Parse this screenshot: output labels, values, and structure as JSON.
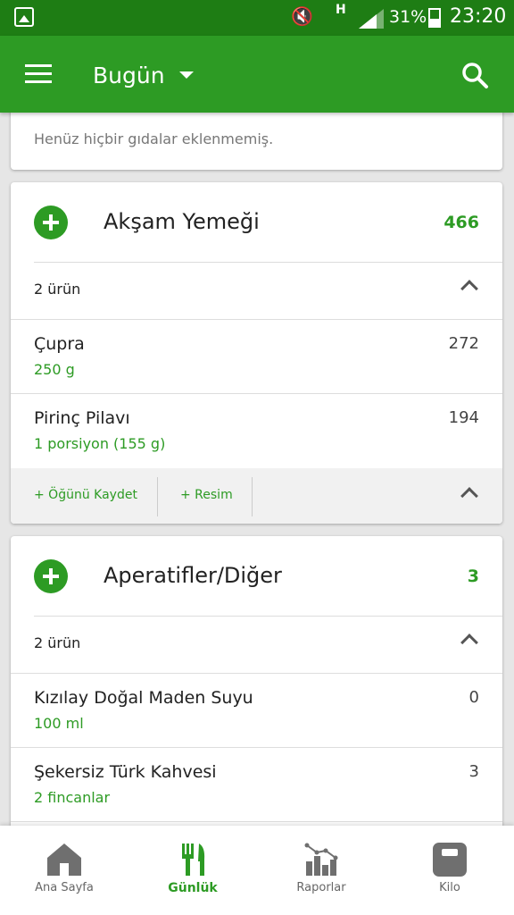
{
  "status_bar": {
    "net_type": "H",
    "battery": "31%",
    "time": "23:20"
  },
  "app_bar": {
    "title": "Bugün",
    "icons": [
      "menu-icon",
      "chevron-down-icon",
      "search-icon"
    ]
  },
  "breakfast_partial": {
    "empty_message": "Henüz hiçbir gıdalar eklenmemiş."
  },
  "meals": [
    {
      "name": "Akşam Yemeği",
      "total": "466",
      "count": "2 ürün",
      "items": [
        {
          "name": "Çupra",
          "amount": "250  g",
          "calories": "272"
        },
        {
          "name": "Pirinç Pilavı",
          "amount": "1  porsiyon (155 g)",
          "calories": "194"
        }
      ],
      "actions": {
        "save": "+ Öğünü Kaydet",
        "photo": "+ Resim"
      }
    },
    {
      "name": "Aperatifler/Diğer",
      "total": "3",
      "count": "2 ürün",
      "items": [
        {
          "name": "Kızılay Doğal Maden Suyu",
          "amount": "100  ml",
          "calories": "0"
        },
        {
          "name": "Şekersiz Türk Kahvesi",
          "amount": "2  fincanlar",
          "calories": "3"
        }
      ]
    }
  ],
  "bottom_nav": [
    {
      "label": "Ana Sayfa",
      "icon": "home-icon",
      "active": false
    },
    {
      "label": "Günlük",
      "icon": "cutlery-icon",
      "active": true
    },
    {
      "label": "Raporlar",
      "icon": "chart-icon",
      "active": false
    },
    {
      "label": "Kilo",
      "icon": "scale-icon",
      "active": false
    }
  ],
  "colors": {
    "status_bar": "#1e7d14",
    "primary": "#2d9b24",
    "background": "#e6e6e6"
  }
}
